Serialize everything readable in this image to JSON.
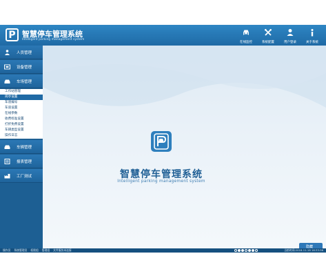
{
  "app": {
    "title": "智慧停车管理系统",
    "subtitle": "Intelligent parking management system"
  },
  "toolbar": [
    {
      "label": "在线监控",
      "icon": "car-icon"
    },
    {
      "label": "系统配置",
      "icon": "tools-icon"
    },
    {
      "label": "用户登录",
      "icon": "user-icon"
    },
    {
      "label": "关于系统",
      "icon": "info-icon"
    }
  ],
  "sidebar": {
    "nav_top": [
      {
        "label": "人员管理",
        "icon": "person-icon"
      },
      {
        "label": "设备管理",
        "icon": "device-icon"
      },
      {
        "label": "车场管理",
        "icon": "car-icon"
      }
    ],
    "submenu": [
      "工作站管理",
      "岗亭设置",
      "车道编号",
      "车道设置",
      "在线参数",
      "收费标准设置",
      "打折免费设置",
      "车辆类型设置",
      "操作日志"
    ],
    "submenu_active_index": 1,
    "nav_bottom": [
      {
        "label": "车辆管理",
        "icon": "car-icon"
      },
      {
        "label": "报表管理",
        "icon": "report-icon"
      },
      {
        "label": "工厂测试",
        "icon": "factory-icon"
      }
    ]
  },
  "main": {
    "title": "智慧停车管理系统",
    "subtitle": "Intelligent parking management system",
    "button_label": "隐藏"
  },
  "statusbar": {
    "items": [
      "操作员",
      "系统管理员",
      "权限组",
      "管理组",
      "文件服务未连接"
    ],
    "time": "当前时间:2018-11-18 16:33:36"
  },
  "colors": {
    "accent": "#1f6aa5",
    "header": "#2e86c4",
    "sidebar": "#1d5f93",
    "statusbar": "#15507f"
  }
}
